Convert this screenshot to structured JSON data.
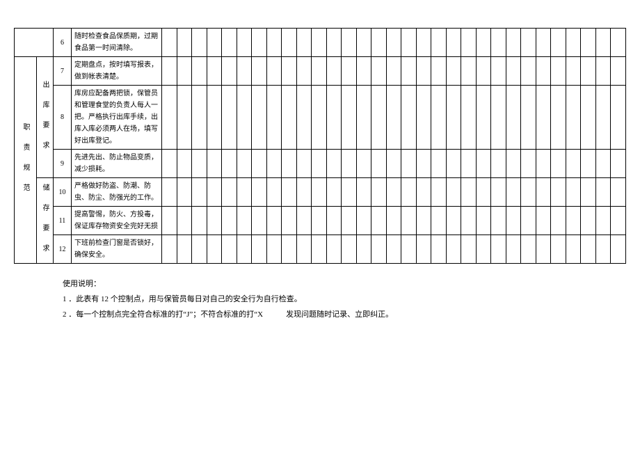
{
  "table": {
    "cat1": "职 责 规 范",
    "groups": [
      {
        "cat2": "",
        "rows": [
          {
            "num": "6",
            "desc": "随时检查食品保质期，过期食品第一时间清除。"
          }
        ]
      },
      {
        "cat2": "出 库 要 求",
        "rows": [
          {
            "num": "7",
            "desc": "定期盘点，按时填写报表，做到帐表清楚。"
          },
          {
            "num": "8",
            "desc": "库房应配备两把锁，保管员和管理食堂的负责人每人一把。严格执行出库手续，出库入库必须两人在场，填写好出库登记。"
          },
          {
            "num": "9",
            "desc": "先进先出、防止物品变质，减少损耗。"
          }
        ]
      },
      {
        "cat2": "储 存 要 求",
        "rows": [
          {
            "num": "10",
            "desc": "严格做好防盗、防潮、防虫、防尘、防强光的工作。"
          },
          {
            "num": "11",
            "desc": "提高警惕，防火、方投毒，保证库存物资安全完好无损"
          },
          {
            "num": "12",
            "desc": "下班前检查门窗是否锁好，确保安全。"
          }
        ]
      }
    ]
  },
  "notes": {
    "title": "使用说明：",
    "line1": "1 ．此表有 12 个控制点，用与保管员每日对自己的安全行为自行检查。",
    "line2": "2 ．每一个控制点完全符合标准的打“J”；不符合标准的打“X　　　发现问题随时记录、立即纠正。"
  }
}
